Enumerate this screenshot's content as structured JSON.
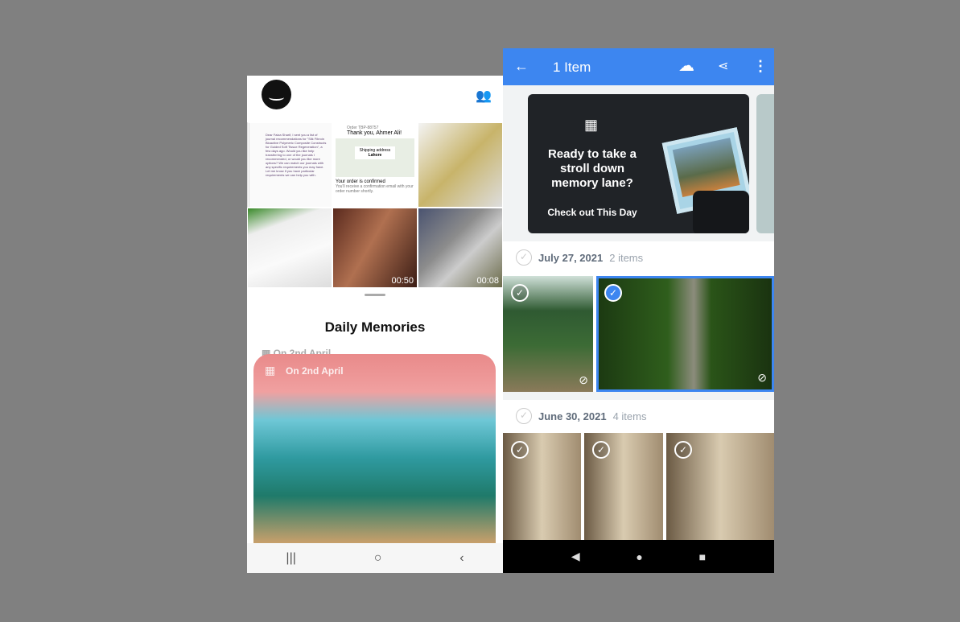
{
  "left_app": {
    "header": {
      "logo": "amazon-smile-logo",
      "people_icon": "people-icon"
    },
    "grid": [
      {
        "type": "document",
        "text": "Dear Faiza Sharif, I sent you a list of journal recommendations for \"Silk Fibroin Bioactive Polymeric Composite Constructs for Guided Soft Tissue Regeneration\", a few days ago. Would you like help transferring to one of the journals I recommended, or would you like more options? We can match our journals with any specific requirements you may have. Let me know if you have particular requirements we can help you with."
      },
      {
        "type": "order",
        "order_no": "Order TBP-88757",
        "thanks": "Thank you, Ahmer Ali!",
        "map_label": "Shipping address",
        "map_city": "Lahore",
        "confirmed": "Your order is confirmed",
        "note": "You'll receive a confirmation email with your order number shortly."
      },
      {
        "type": "photo",
        "desc": "leopard tie"
      },
      {
        "type": "photo",
        "desc": "zebra tie"
      },
      {
        "type": "video",
        "duration": "00:50"
      },
      {
        "type": "video",
        "duration": "00:08"
      }
    ],
    "section_title": "Daily Memories",
    "memory_label": "On 2nd April",
    "nav": [
      "|||",
      "○",
      "‹"
    ]
  },
  "right_app": {
    "header": {
      "title": "1 Item",
      "icons": [
        "back-arrow-icon",
        "cloud-upload-icon",
        "share-icon",
        "more-vert-icon"
      ]
    },
    "promo": {
      "question": "Ready to take a stroll down memory lane?",
      "cta": "Check out This Day"
    },
    "groups": [
      {
        "date": "July 27, 2021",
        "count": "2 items",
        "photos": [
          {
            "desc": "forest trail",
            "selected": false
          },
          {
            "desc": "owl in tree",
            "selected": true
          }
        ]
      },
      {
        "date": "June 30, 2021",
        "count": "4 items",
        "photos": [
          {
            "selected": false
          },
          {
            "selected": false
          },
          {
            "selected": false
          }
        ]
      }
    ],
    "accent": "#3d86f0",
    "nav": [
      "◀",
      "●",
      "■"
    ]
  }
}
